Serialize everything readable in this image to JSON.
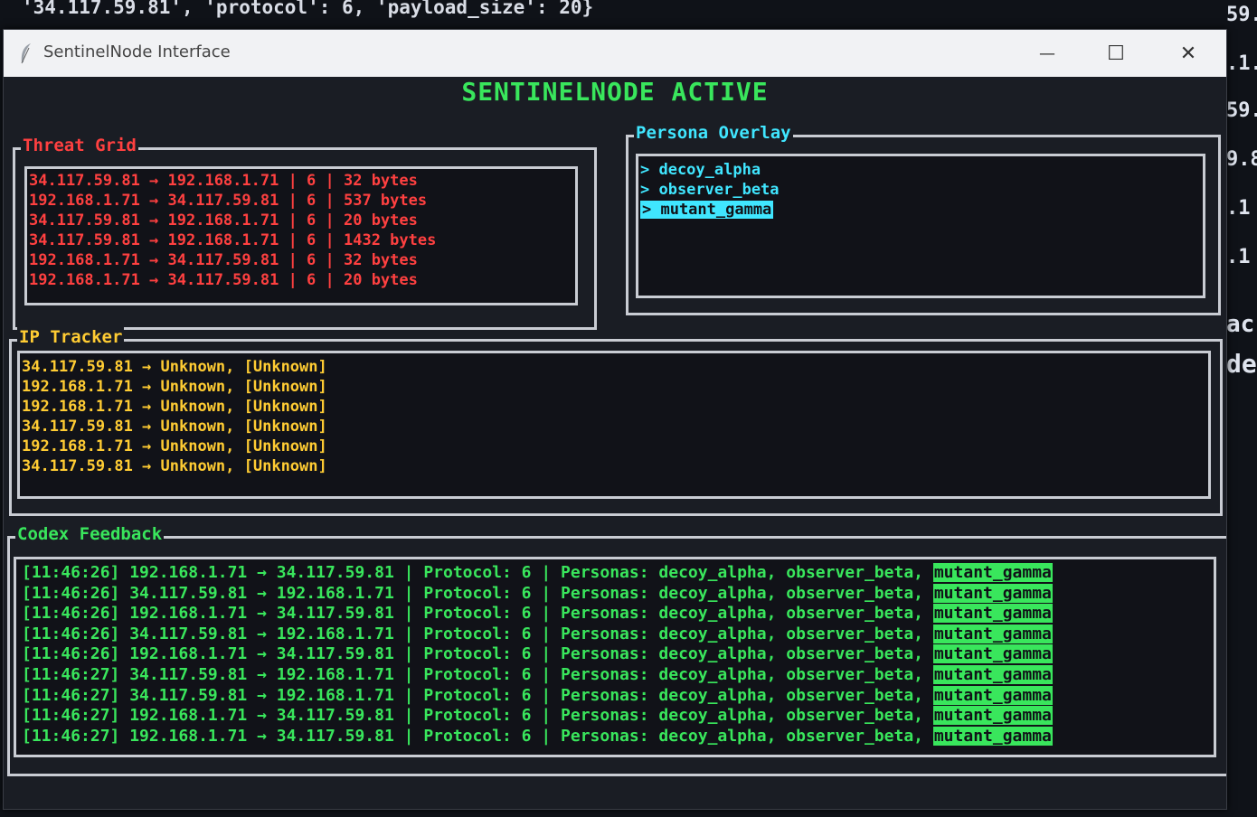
{
  "background_terminal": {
    "top_line": "'34.117.59.81', 'protocol': 6, 'payload_size': 20}",
    "side_fragments": [
      "59.",
      ".1.",
      "59.",
      "9.8",
      ".1",
      ".1",
      "ac",
      "de"
    ]
  },
  "window": {
    "title": "SentinelNode Interface",
    "controls": {
      "minimize": "—",
      "maximize": "☐",
      "close": "✕"
    }
  },
  "app": {
    "heading": "SENTINELNODE ACTIVE"
  },
  "threat_grid": {
    "label": "Threat Grid",
    "rows": [
      "34.117.59.81 → 192.168.1.71 | 6 | 32 bytes",
      "192.168.1.71 → 34.117.59.81 | 6 | 537 bytes",
      "34.117.59.81 → 192.168.1.71 | 6 | 20 bytes",
      "34.117.59.81 → 192.168.1.71 | 6 | 1432 bytes",
      "192.168.1.71 → 34.117.59.81 | 6 | 32 bytes",
      "192.168.1.71 → 34.117.59.81 | 6 | 20 bytes"
    ]
  },
  "persona_overlay": {
    "label": "Persona Overlay",
    "items": [
      {
        "text": "> decoy_alpha",
        "selected": false
      },
      {
        "text": "> observer_beta",
        "selected": false
      },
      {
        "text": "> mutant_gamma",
        "selected": true
      }
    ]
  },
  "ip_tracker": {
    "label": "IP Tracker",
    "rows": [
      "34.117.59.81 → Unknown,  [Unknown]",
      "192.168.1.71 → Unknown,  [Unknown]",
      "192.168.1.71 → Unknown,  [Unknown]",
      "34.117.59.81 → Unknown,  [Unknown]",
      "192.168.1.71 → Unknown,  [Unknown]",
      "34.117.59.81 → Unknown,  [Unknown]"
    ]
  },
  "codex_feedback": {
    "label": "Codex Feedback",
    "rows": [
      {
        "text": "[11:46:26] 192.168.1.71 → 34.117.59.81 | Protocol: 6 | Personas: decoy_alpha, observer_beta, ",
        "hl": "mutant_gamma"
      },
      {
        "text": "[11:46:26] 34.117.59.81 → 192.168.1.71 | Protocol: 6 | Personas: decoy_alpha, observer_beta, ",
        "hl": "mutant_gamma"
      },
      {
        "text": "[11:46:26] 192.168.1.71 → 34.117.59.81 | Protocol: 6 | Personas: decoy_alpha, observer_beta, ",
        "hl": "mutant_gamma"
      },
      {
        "text": "[11:46:26] 34.117.59.81 → 192.168.1.71 | Protocol: 6 | Personas: decoy_alpha, observer_beta, ",
        "hl": "mutant_gamma"
      },
      {
        "text": "[11:46:26] 192.168.1.71 → 34.117.59.81 | Protocol: 6 | Personas: decoy_alpha, observer_beta, ",
        "hl": "mutant_gamma"
      },
      {
        "text": "[11:46:27] 34.117.59.81 → 192.168.1.71 | Protocol: 6 | Personas: decoy_alpha, observer_beta, ",
        "hl": "mutant_gamma"
      },
      {
        "text": "[11:46:27] 34.117.59.81 → 192.168.1.71 | Protocol: 6 | Personas: decoy_alpha, observer_beta, ",
        "hl": "mutant_gamma"
      },
      {
        "text": "[11:46:27] 192.168.1.71 → 34.117.59.81 | Protocol: 6 | Personas: decoy_alpha, observer_beta, ",
        "hl": "mutant_gamma"
      },
      {
        "text": "[11:46:27] 192.168.1.71 → 34.117.59.81 | Protocol: 6 | Personas: decoy_alpha, observer_beta, ",
        "hl": "mutant_gamma"
      }
    ]
  },
  "colors": {
    "heading": "#39e65c",
    "threat": "#ff4040",
    "persona": "#40e6ff",
    "ip": "#ffcc33",
    "codex": "#39e65c"
  }
}
